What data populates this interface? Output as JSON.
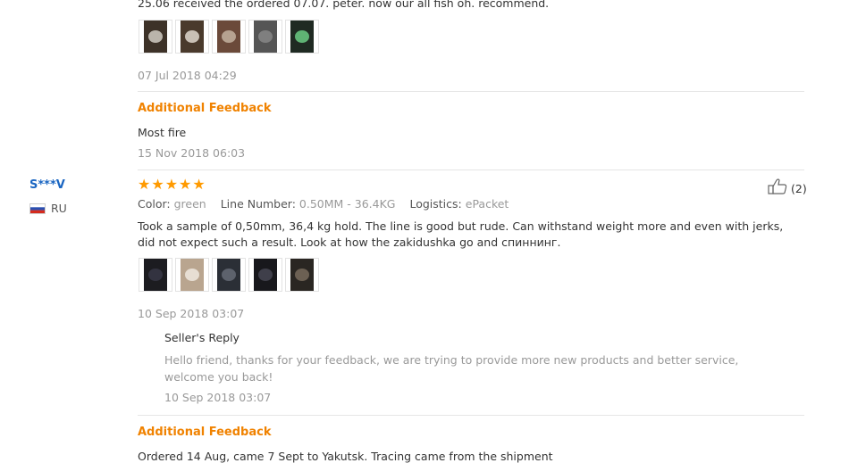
{
  "review1": {
    "text_partial": "25.06 received the ordered 07.07. peter. now our all fish oh. recommend.",
    "photos": [
      {
        "name": "photo-1",
        "bg": "#3d3228",
        "fg": "#d9d4cc"
      },
      {
        "name": "photo-2",
        "bg": "#4a3a2c",
        "fg": "#e8e2d8"
      },
      {
        "name": "photo-3",
        "bg": "#6b4a3a",
        "fg": "#c9b8a6"
      },
      {
        "name": "photo-4",
        "bg": "#555555",
        "fg": "#8a8a8a"
      },
      {
        "name": "photo-5",
        "bg": "#1f2a22",
        "fg": "#6fd68a"
      }
    ],
    "date": "07 Jul 2018 04:29",
    "additional_feedback_label": "Additional Feedback",
    "additional_text": "Most fire",
    "additional_date": "15 Nov 2018 06:03"
  },
  "review2": {
    "user": "S***V",
    "country": "RU",
    "rating": 5,
    "helpful_count": "(2)",
    "color_label": "Color:",
    "color_value": "green",
    "line_label": "Line Number:",
    "line_value": "0.50MM - 36.4KG",
    "logistics_label": "Logistics:",
    "logistics_value": "ePacket",
    "text": "Took a sample of 0,50mm, 36,4 kg hold. The line is good but rude. Can withstand weight more and even with jerks, did not expect such a result. Look at how the zakidushka go and спиннинг.",
    "photos": [
      {
        "name": "photo-1",
        "bg": "#1c1c20",
        "fg": "#3a3a48"
      },
      {
        "name": "photo-2",
        "bg": "#b9a58f",
        "fg": "#f2ece4"
      },
      {
        "name": "photo-3",
        "bg": "#2b2f36",
        "fg": "#6a6f7a"
      },
      {
        "name": "photo-4",
        "bg": "#18181c",
        "fg": "#4a4a56"
      },
      {
        "name": "photo-5",
        "bg": "#2a2622",
        "fg": "#7d6f60"
      }
    ],
    "date": "10 Sep 2018 03:07",
    "seller_reply_label": "Seller's Reply",
    "seller_reply_text": "Hello friend, thanks for your feedback, we are trying to provide more new products and better service, welcome you back!",
    "seller_reply_date": "10 Sep 2018 03:07",
    "additional_feedback_label": "Additional Feedback",
    "additional_text_partial": "Ordered 14 Aug, came 7 Sept to Yakutsk. Tracing came from the shipment"
  },
  "colors": {
    "accent_orange": "#f08200",
    "user_blue": "#1a66c2",
    "star": "#ff9a00",
    "muted": "#999999"
  }
}
